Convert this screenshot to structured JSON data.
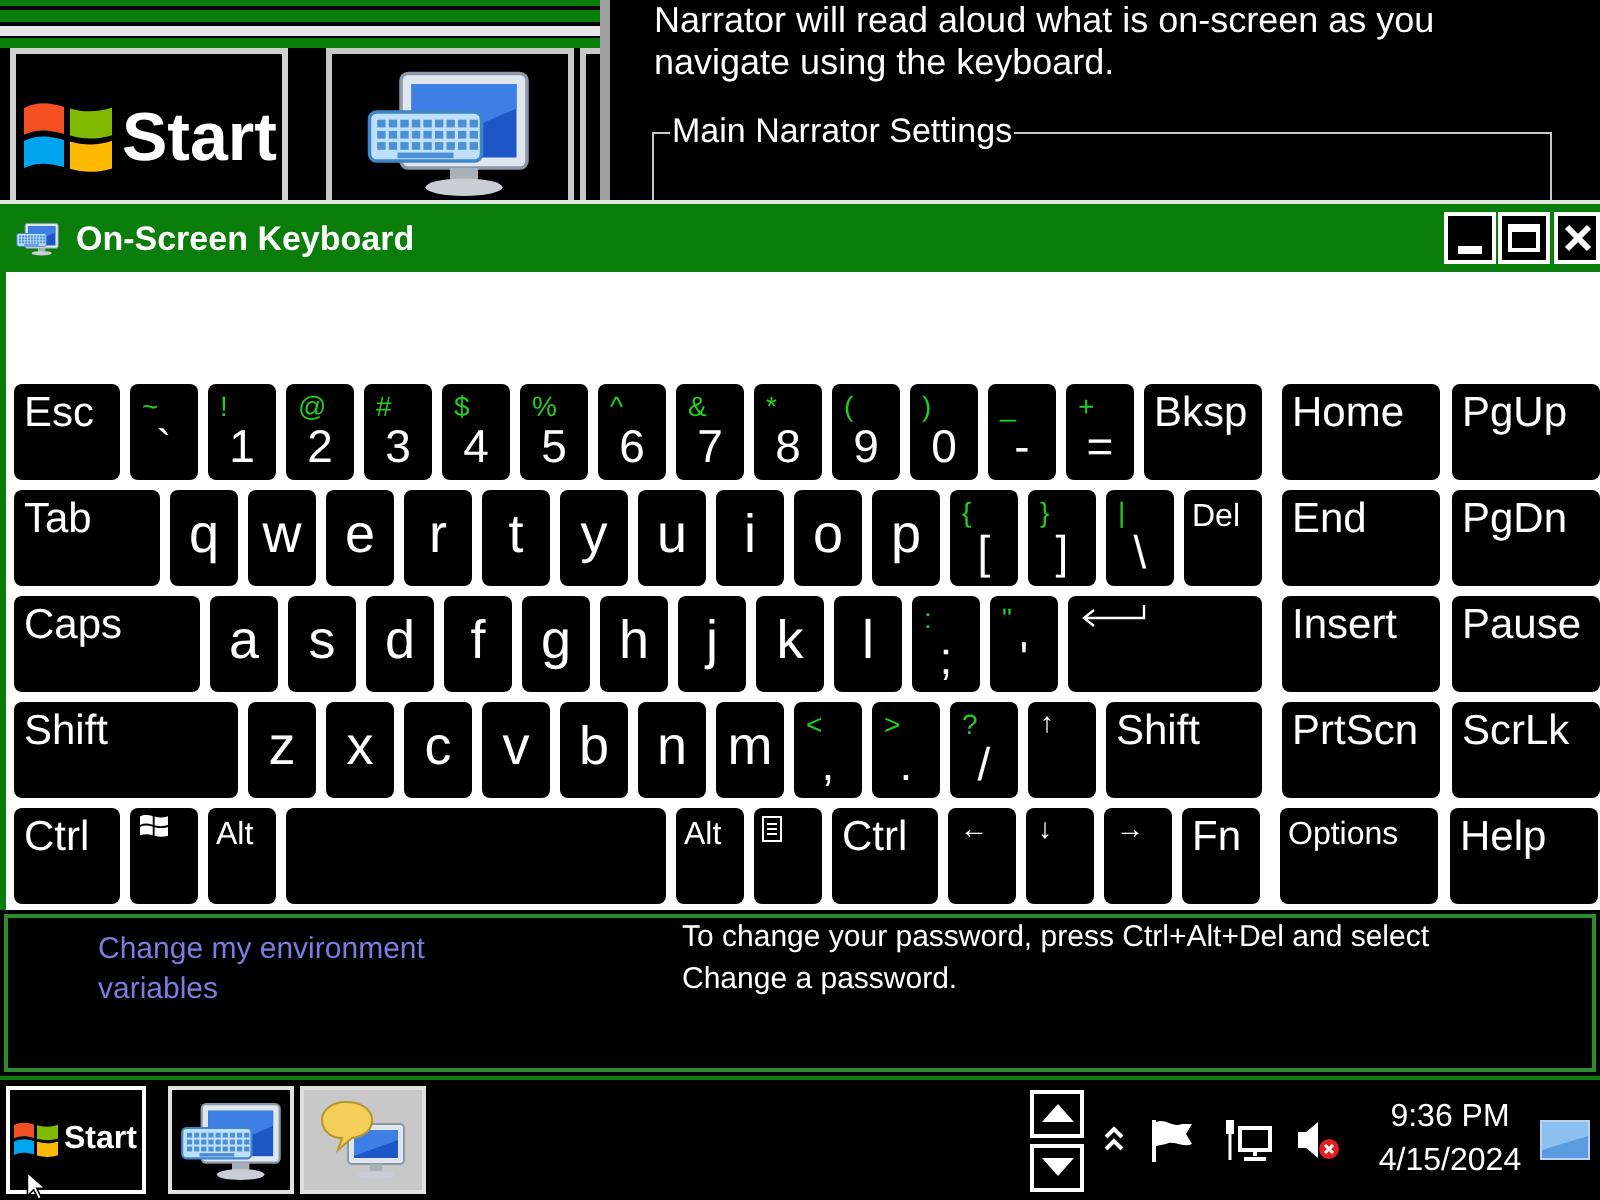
{
  "magnifier": {
    "start_label": "Start"
  },
  "narrator": {
    "description": "Narrator will read aloud what is on-screen as you navigate using the keyboard.",
    "group_title": "Main Narrator Settings"
  },
  "keyboard_window": {
    "title": "On-Screen Keyboard",
    "rows": [
      {
        "keys": [
          {
            "kind": "function",
            "label": "Esc"
          },
          {
            "kind": "symbol",
            "shift": "~",
            "label": "`"
          },
          {
            "kind": "symbol",
            "shift": "!",
            "label": "1"
          },
          {
            "kind": "symbol",
            "shift": "@",
            "label": "2"
          },
          {
            "kind": "symbol",
            "shift": "#",
            "label": "3"
          },
          {
            "kind": "symbol",
            "shift": "$",
            "label": "4"
          },
          {
            "kind": "symbol",
            "shift": "%",
            "label": "5"
          },
          {
            "kind": "symbol",
            "shift": "^",
            "label": "6"
          },
          {
            "kind": "symbol",
            "shift": "&",
            "label": "7"
          },
          {
            "kind": "symbol",
            "shift": "*",
            "label": "8"
          },
          {
            "kind": "symbol",
            "shift": "(",
            "label": "9"
          },
          {
            "kind": "symbol",
            "shift": ")",
            "label": "0"
          },
          {
            "kind": "symbol",
            "shift": "_",
            "label": "-"
          },
          {
            "kind": "symbol",
            "shift": "+",
            "label": "="
          },
          {
            "kind": "function",
            "label": "Bksp"
          }
        ],
        "nav_keys": [
          {
            "kind": "function",
            "label": "Home"
          },
          {
            "kind": "function",
            "label": "PgUp"
          }
        ]
      },
      {
        "keys": [
          {
            "kind": "function",
            "label": "Tab"
          },
          {
            "kind": "letter",
            "label": "q"
          },
          {
            "kind": "letter",
            "label": "w"
          },
          {
            "kind": "letter",
            "label": "e"
          },
          {
            "kind": "letter",
            "label": "r"
          },
          {
            "kind": "letter",
            "label": "t"
          },
          {
            "kind": "letter",
            "label": "y"
          },
          {
            "kind": "letter",
            "label": "u"
          },
          {
            "kind": "letter",
            "label": "i"
          },
          {
            "kind": "letter",
            "label": "o"
          },
          {
            "kind": "letter",
            "label": "p"
          },
          {
            "kind": "symbol",
            "shift": "{",
            "label": "["
          },
          {
            "kind": "symbol",
            "shift": "}",
            "label": "]"
          },
          {
            "kind": "symbol",
            "shift": "|",
            "label": "\\"
          },
          {
            "kind": "small",
            "label": "Del"
          }
        ],
        "nav_keys": [
          {
            "kind": "function",
            "label": "End"
          },
          {
            "kind": "function",
            "label": "PgDn"
          }
        ]
      },
      {
        "keys": [
          {
            "kind": "function",
            "label": "Caps"
          },
          {
            "kind": "letter",
            "label": "a"
          },
          {
            "kind": "letter",
            "label": "s"
          },
          {
            "kind": "letter",
            "label": "d"
          },
          {
            "kind": "letter",
            "label": "f"
          },
          {
            "kind": "letter",
            "label": "g"
          },
          {
            "kind": "letter",
            "label": "h"
          },
          {
            "kind": "letter",
            "label": "j"
          },
          {
            "kind": "letter",
            "label": "k"
          },
          {
            "kind": "letter",
            "label": "l"
          },
          {
            "kind": "symbol",
            "shift": ":",
            "label": ";"
          },
          {
            "kind": "symbol",
            "shift": "\"",
            "label": "'"
          },
          {
            "kind": "enter"
          }
        ],
        "nav_keys": [
          {
            "kind": "function",
            "label": "Insert"
          },
          {
            "kind": "function",
            "label": "Pause"
          }
        ]
      },
      {
        "keys": [
          {
            "kind": "function",
            "label": "Shift"
          },
          {
            "kind": "letter",
            "label": "z"
          },
          {
            "kind": "letter",
            "label": "x"
          },
          {
            "kind": "letter",
            "label": "c"
          },
          {
            "kind": "letter",
            "label": "v"
          },
          {
            "kind": "letter",
            "label": "b"
          },
          {
            "kind": "letter",
            "label": "n"
          },
          {
            "kind": "letter",
            "label": "m"
          },
          {
            "kind": "symbol",
            "shift": "<",
            "label": ","
          },
          {
            "kind": "symbol",
            "shift": ">",
            "label": "."
          },
          {
            "kind": "symbol",
            "shift": "?",
            "label": "/"
          },
          {
            "kind": "arrow",
            "label": "↑"
          },
          {
            "kind": "function",
            "label": "Shift"
          }
        ],
        "nav_keys": [
          {
            "kind": "function",
            "label": "PrtScn"
          },
          {
            "kind": "function",
            "label": "ScrLk"
          }
        ]
      },
      {
        "keys": [
          {
            "kind": "function",
            "label": "Ctrl"
          },
          {
            "kind": "windows"
          },
          {
            "kind": "small",
            "label": "Alt"
          },
          {
            "kind": "space"
          },
          {
            "kind": "small",
            "label": "Alt"
          },
          {
            "kind": "menu"
          },
          {
            "kind": "function",
            "label": "Ctrl"
          },
          {
            "kind": "arrow",
            "label": "←"
          },
          {
            "kind": "arrow",
            "label": "↓"
          },
          {
            "kind": "arrow",
            "label": "→"
          },
          {
            "kind": "function",
            "label": "Fn"
          }
        ],
        "nav_keys": [
          {
            "kind": "small",
            "label": "Options"
          },
          {
            "kind": "function",
            "label": "Help"
          }
        ]
      }
    ]
  },
  "info_panel": {
    "link": "Change my environment variables",
    "hint": "To change your password, press Ctrl+Alt+Del and select Change a password."
  },
  "taskbar": {
    "start_label": "Start",
    "apps": [
      {
        "kind": "keyboard",
        "selected": false
      },
      {
        "kind": "narrator",
        "selected": true
      }
    ],
    "volume_muted": true,
    "time": "9:36 PM",
    "date": "4/15/2024"
  }
}
